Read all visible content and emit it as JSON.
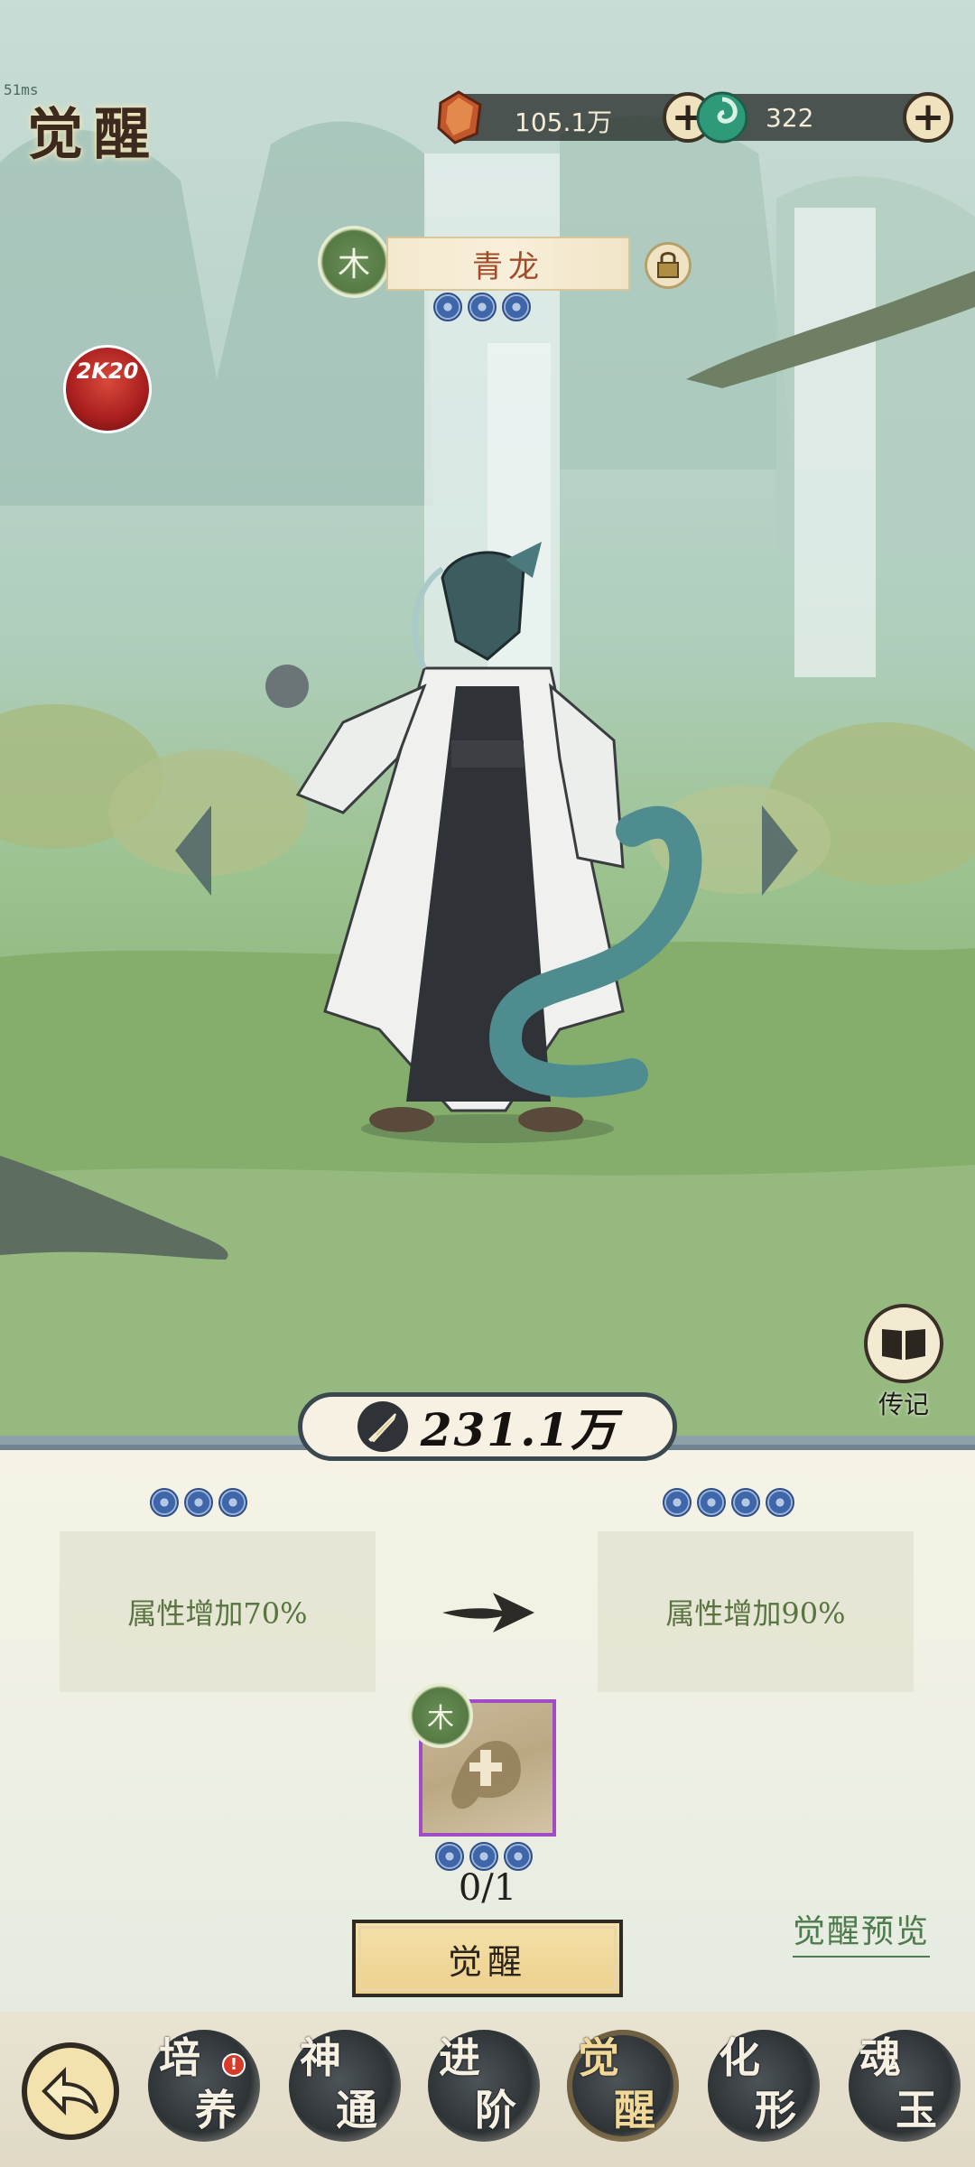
{
  "status": {
    "fps": "51ms"
  },
  "header": {
    "title": "觉醒"
  },
  "currencies": [
    {
      "icon": "crystal-gem-icon",
      "value": "105.1万"
    },
    {
      "icon": "jade-swirl-icon",
      "value": "322"
    }
  ],
  "character": {
    "element": "木",
    "name": "青龙",
    "stars": 3
  },
  "avatar_label": "2K20",
  "biography_label": "传记",
  "power": {
    "value": "231.1万"
  },
  "awaken": {
    "current_stars": 3,
    "next_stars": 4,
    "current_attr": "属性增加70%",
    "next_attr": "属性增加90%",
    "material_element": "木",
    "material_stars": 3,
    "material_count": "0/1",
    "button_label": "觉醒",
    "preview_label": "觉醒预览"
  },
  "nav": {
    "items": [
      {
        "label": "培\n  养",
        "badge": "!"
      },
      {
        "label": "神\n  通"
      },
      {
        "label": "进\n  阶"
      },
      {
        "label": "觉\n  醒",
        "active": true
      },
      {
        "label": "化\n  形"
      },
      {
        "label": "魂\n  玉"
      }
    ]
  }
}
